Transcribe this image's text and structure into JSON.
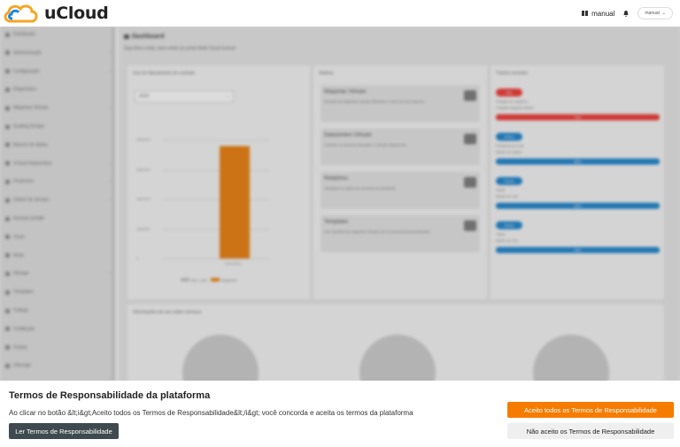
{
  "app": {
    "brand": "uCloud"
  },
  "header": {
    "manual_label": "manual",
    "user_label": "manual"
  },
  "sidebar": {
    "items": [
      {
        "label": "Dashboard",
        "icon": "home-icon"
      },
      {
        "label": "Administração",
        "icon": "admin-icon"
      },
      {
        "label": "Configuração",
        "icon": "settings-icon"
      },
      {
        "label": "Diagnóstico",
        "icon": "diagnostic-icon"
      },
      {
        "label": "Máquinas Virtuais",
        "icon": "server-icon"
      },
      {
        "label": "Guiding Groups",
        "icon": "group-icon"
      },
      {
        "label": "Bancos de dados",
        "icon": "database-icon"
      },
      {
        "label": "vCloud Datacenters",
        "icon": "cloud-icon"
      },
      {
        "label": "Financeiro",
        "icon": "money-icon"
      },
      {
        "label": "Ordem de Serviço",
        "icon": "order-icon"
      },
      {
        "label": "Acessar portátil",
        "icon": "portal-icon"
      },
      {
        "label": "Voust",
        "icon": "box-icon"
      },
      {
        "label": "Rede",
        "icon": "network-icon"
      },
      {
        "label": "Storage",
        "icon": "storage-icon"
      },
      {
        "label": "Templates",
        "icon": "template-icon"
      },
      {
        "label": "Tráfego",
        "icon": "traffic-icon"
      },
      {
        "label": "Certificado",
        "icon": "cert-icon"
      },
      {
        "label": "Tickets",
        "icon": "ticket-icon"
      },
      {
        "label": "vStorage",
        "icon": "vstorage-icon"
      }
    ]
  },
  "dashboard": {
    "title": "Dashboard",
    "subtitle": "Seja Bem-vindo, bem-vindo ao portal Multi Cloud Ucloud",
    "usage_card": {
      "title": "Uso do faturamento do contrato",
      "select_value": "2020"
    },
    "menu_card": {
      "title": "Atalhos",
      "tiles": [
        {
          "title": "Máquinas Virtuais",
          "desc": "Acessar as máquinas virtuais Windows e Linux de sua empresa"
        },
        {
          "title": "Datacenters Virtuais",
          "desc": "Controle os recursos alocados e Virtuais disponíveis"
        },
        {
          "title": "Relatórios",
          "desc": "Visualizar os dados de consumo do ambiente"
        },
        {
          "title": "Templates",
          "desc": "Crie modelos de máquinas virtuais com os recursos personalizados"
        }
      ]
    },
    "tickets_card": {
      "title": "Tickets recentes",
      "tickets": [
        {
          "badge": "Alto",
          "line1": "Criação de máquina",
          "line2": "Criação máquina virtual",
          "bar": "75%",
          "color": "#e53935"
        },
        {
          "badge": "Médio",
          "line1": "Problema de rede",
          "line2": "Ajuste de regras",
          "bar": "85%",
          "color": "#1e7fc4"
        },
        {
          "badge": "Médio",
          "line1": "Ticket",
          "line2": "Ajuste de rota",
          "bar": "80%",
          "color": "#1e7fc4"
        },
        {
          "badge": "Médio",
          "line1": "Ticket",
          "line2": "Ajuste de rota",
          "bar": "90%",
          "color": "#1e7fc4"
        }
      ]
    },
    "info_card": {
      "title": "Informações de uso sobre serviços"
    }
  },
  "chart_data": {
    "type": "bar",
    "categories": [
      "Dezembro"
    ],
    "series": [
      {
        "name": "Máquinas",
        "values": [
          380
        ]
      }
    ],
    "legend": [
      "Até o mês",
      "Máquinas"
    ],
    "y_ticks": [
      "400,00 €",
      "300,00 €",
      "200,00 €",
      "100,00 €",
      "0"
    ],
    "ylim": [
      0,
      400
    ],
    "colors": {
      "series": "#e07b10"
    }
  },
  "consent": {
    "title": "Termos de Responsabilidade da plataforma",
    "text": "Ao clicar no botão &lt;i&gt;Aceito todos os Termos de Responsabilidade&lt;/i&gt; você concorda e aceita os termos da plataforma",
    "read_button": "Ler Termos de Responsabilidade",
    "accept_button": "Aceito todos os Termos de Responsabilidade",
    "reject_button": "Não aceito os Termos de Responsabilidade",
    "colors": {
      "accept": "#f57c00",
      "read": "#3e4a4f"
    }
  }
}
